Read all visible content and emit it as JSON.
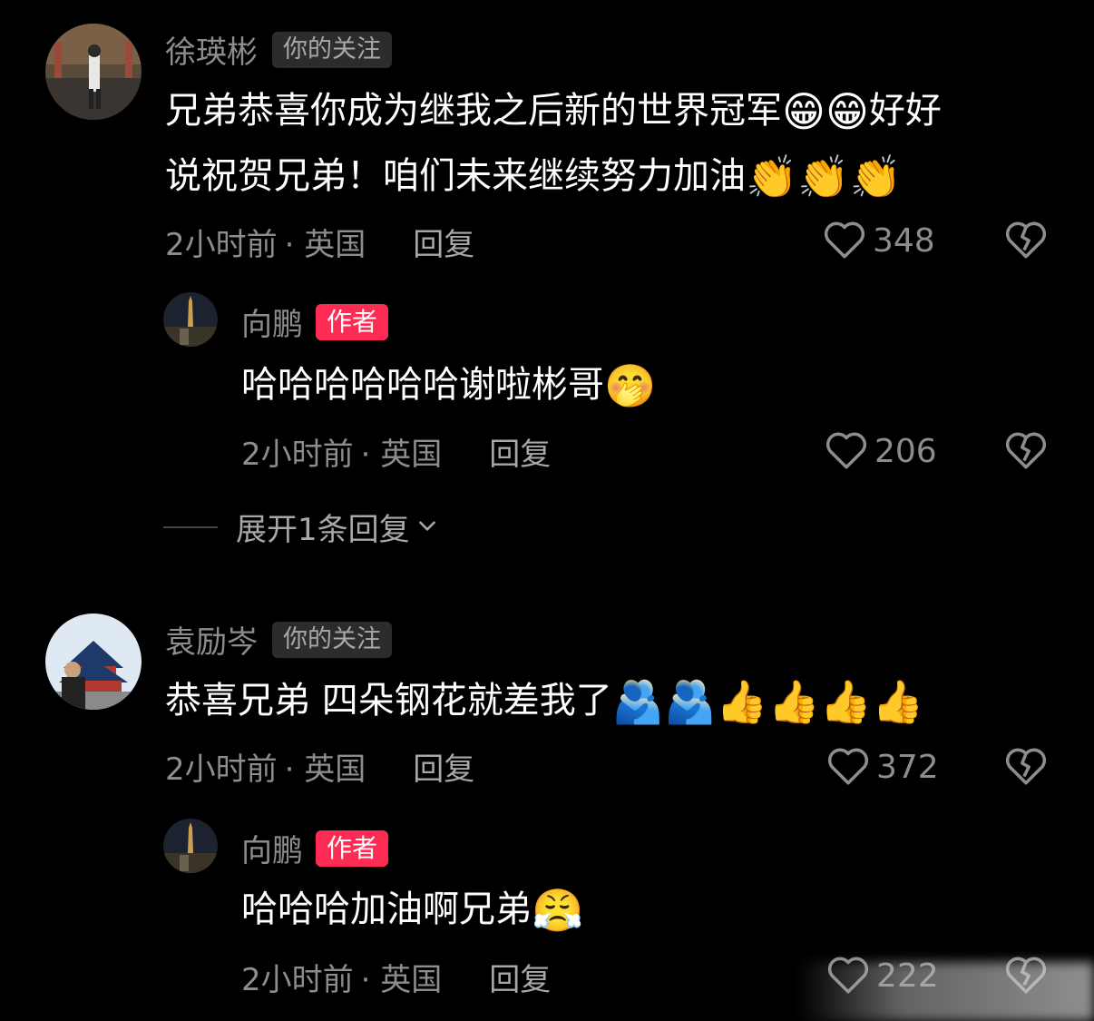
{
  "comments": [
    {
      "username": "徐瑛彬",
      "tag": "你的关注",
      "text_line1": "兄弟恭喜你成为继我之后新的世界冠军",
      "emoji_line1": "😁😁",
      "text_line1_tail": "好好",
      "text_line2": "说祝贺兄弟！咱们未来继续努力加油",
      "emoji_line2": "👏👏👏",
      "time": "2小时前",
      "location": "· 英国",
      "reply_label": "回复",
      "likes": "348",
      "replies": [
        {
          "username": "向鹏",
          "tag": "作者",
          "text": "哈哈哈哈哈哈谢啦彬哥",
          "emoji": "🤭",
          "time": "2小时前",
          "location": "· 英国",
          "reply_label": "回复",
          "likes": "206"
        }
      ],
      "expand_label": "展开1条回复"
    },
    {
      "username": "袁励岑",
      "tag": "你的关注",
      "text": "恭喜兄弟 四朵钢花就差我了",
      "emoji": "🫂🫂👍👍👍👍",
      "time": "2小时前",
      "location": "· 英国",
      "reply_label": "回复",
      "likes": "372",
      "replies": [
        {
          "username": "向鹏",
          "tag": "作者",
          "text": "哈哈哈加油啊兄弟",
          "emoji": "😤",
          "time": "2小时前",
          "location": "· 英国",
          "reply_label": "回复",
          "likes": "222"
        }
      ]
    }
  ],
  "colors": {
    "background": "#000000",
    "author_tag": "#fe2c55",
    "follow_tag_bg": "#2c2c2c",
    "muted_text": "#8d8d8d"
  },
  "icons": [
    "heart-icon",
    "broken-heart-icon",
    "chevron-down-icon"
  ]
}
